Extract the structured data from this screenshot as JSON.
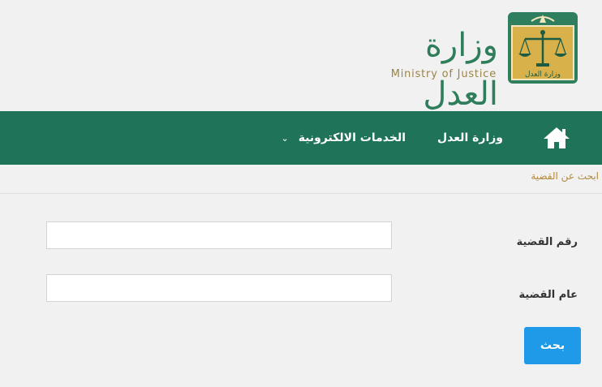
{
  "header": {
    "logo_ar": "وزارة العدل",
    "logo_en": "Ministry of Justice",
    "emblem_caption": "وزارة العدل",
    "emblem_icon": "scales-of-justice-icon"
  },
  "nav": {
    "home_icon": "home-icon",
    "items": [
      {
        "label": "وزارة العدل"
      },
      {
        "label": "الخدمات الالكترونية",
        "chevron": "⌄"
      }
    ]
  },
  "breadcrumb": "ابحث عن القضية",
  "form": {
    "case_number_label": "رقم القضية",
    "case_number_value": "",
    "case_year_label": "عام القضية",
    "case_year_value": "",
    "search_button": "بحث"
  },
  "colors": {
    "nav_bg": "#1e7358",
    "brand_green": "#2e7d5b",
    "brand_gold": "#9b8448",
    "breadcrumb": "#b08a3e",
    "button": "#1e9ae8"
  }
}
